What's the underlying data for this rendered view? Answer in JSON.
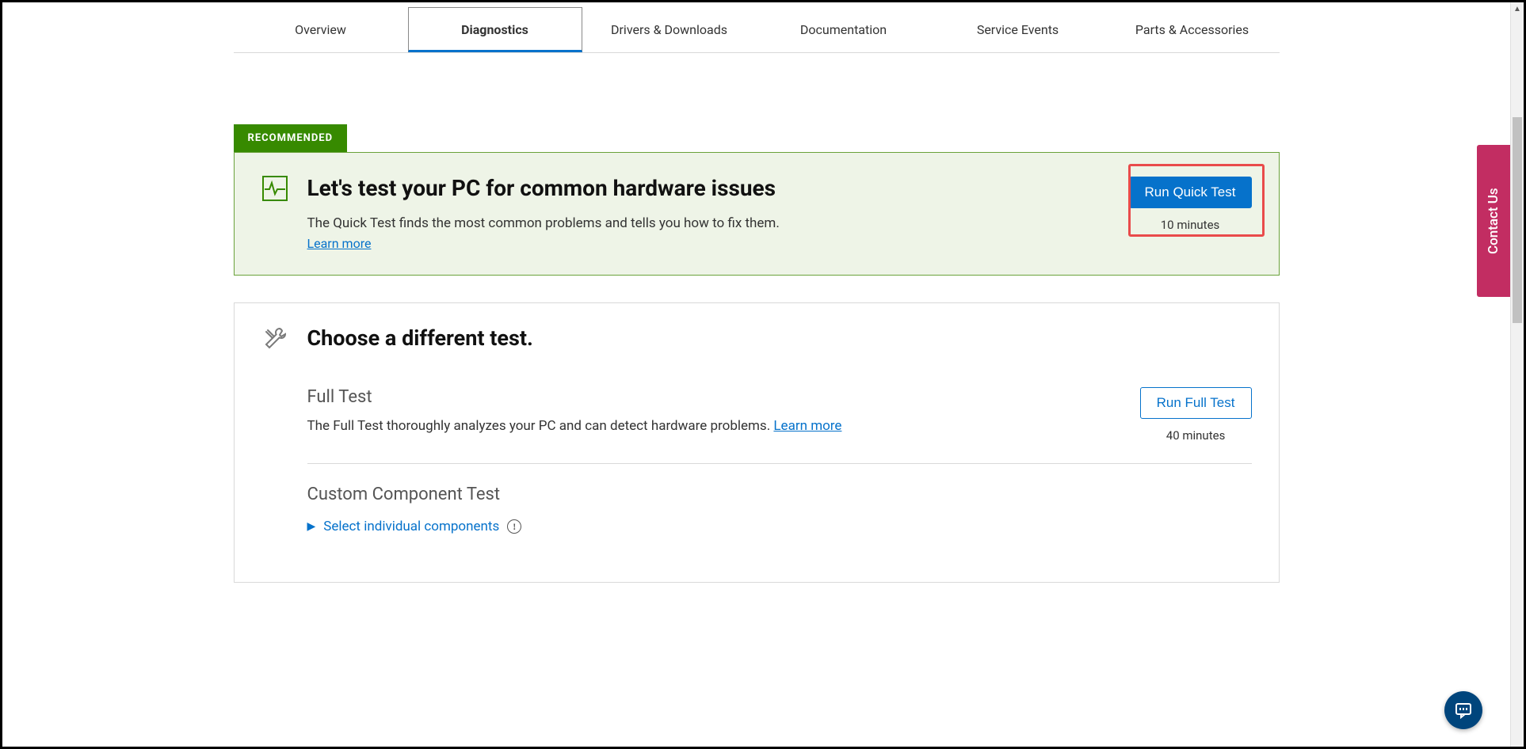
{
  "tabs": {
    "overview": "Overview",
    "diagnostics": "Diagnostics",
    "drivers": "Drivers & Downloads",
    "documentation": "Documentation",
    "service_events": "Service Events",
    "parts": "Parts & Accessories"
  },
  "recommended": {
    "badge": "RECOMMENDED",
    "title": "Let's test your PC for common hardware issues",
    "desc": "The Quick Test finds the most common problems and tells you how to fix them.",
    "learn_more": "Learn more",
    "button": "Run Quick Test",
    "duration": "10 minutes"
  },
  "alt": {
    "title": "Choose a different test.",
    "full": {
      "title": "Full Test",
      "desc": "The Full Test thoroughly analyzes your PC and can detect hardware problems. ",
      "learn_more": "Learn more",
      "button": "Run Full Test",
      "duration": "40 minutes"
    },
    "custom": {
      "title": "Custom Component Test",
      "select": "Select individual components"
    }
  },
  "contact": "Contact Us"
}
